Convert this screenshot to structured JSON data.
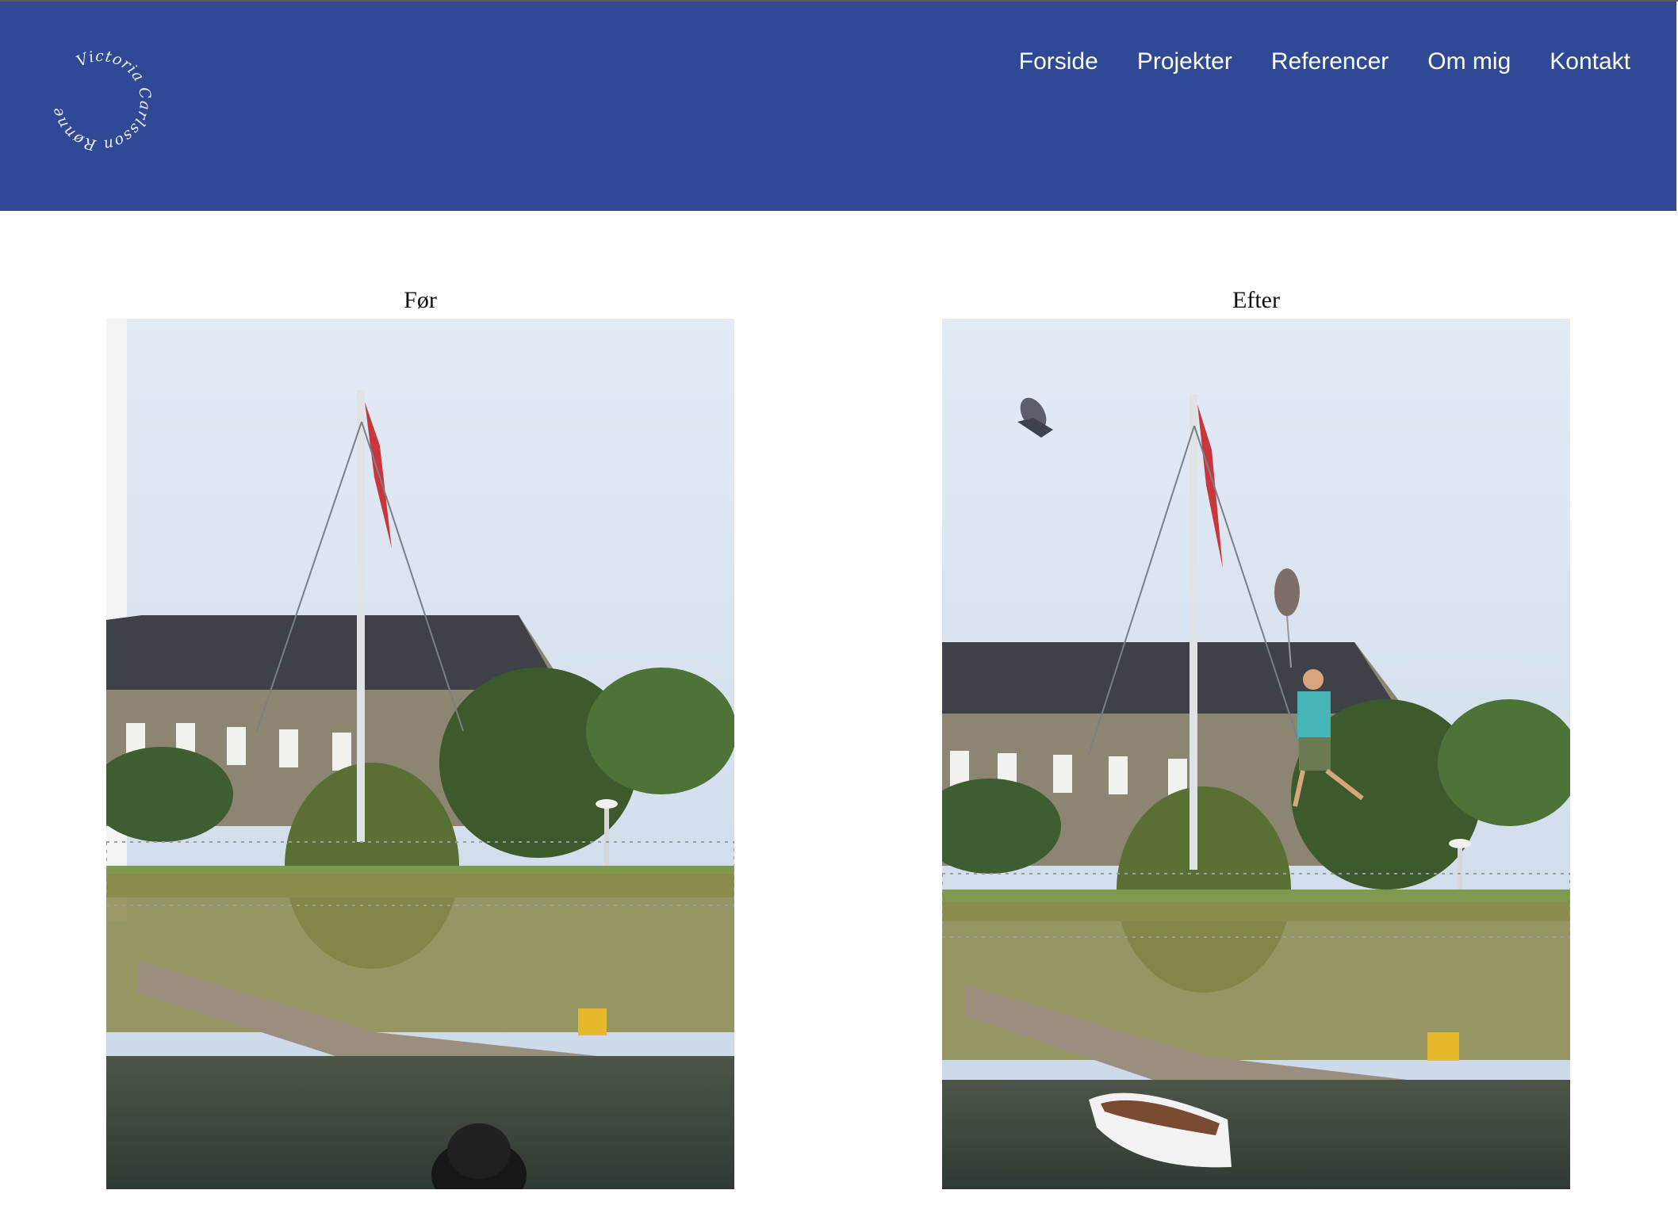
{
  "logo": {
    "text": "Victoria Carlsson Rønne"
  },
  "nav": {
    "items": [
      "Forside",
      "Projekter",
      "Referencer",
      "Om mig",
      "Kontakt"
    ]
  },
  "gallery": {
    "before": {
      "caption": "Før"
    },
    "after": {
      "caption": "Efter"
    }
  },
  "colors": {
    "header": "#2f4995",
    "nav_text": "#ffffff",
    "page_bg": "#ffffff"
  }
}
